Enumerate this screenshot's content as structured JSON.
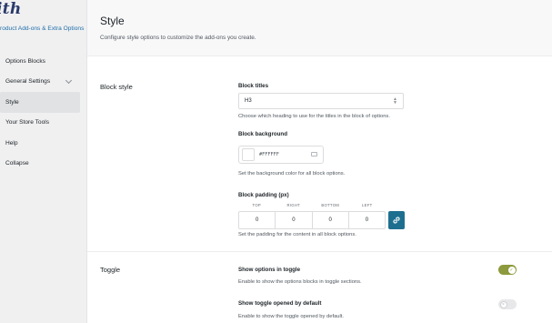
{
  "sidebar": {
    "logo": "ith",
    "plugin_name": "roduct Add-ons & Extra Options",
    "items": [
      {
        "label": "Options Blocks"
      },
      {
        "label": "General Settings"
      },
      {
        "label": "Style"
      },
      {
        "label": "Your Store Tools"
      },
      {
        "label": "Help"
      },
      {
        "label": "Collapse"
      }
    ]
  },
  "header": {
    "title": "Style",
    "description": "Configure style options to customize the add-ons you create."
  },
  "block_style": {
    "section_title": "Block style",
    "titles": {
      "label": "Block titles",
      "value": "H3",
      "help": "Choose which heading to use for the titles in the block of options."
    },
    "background": {
      "label": "Block background",
      "color_value": "#FFFFFF",
      "swatch_color": "#ffffff",
      "help": "Set the background color for all block options."
    },
    "padding": {
      "label": "Block padding (px)",
      "columns": [
        {
          "label": "TOP",
          "value": "0"
        },
        {
          "label": "RIGHT",
          "value": "0"
        },
        {
          "label": "BOTTOM",
          "value": "0"
        },
        {
          "label": "LEFT",
          "value": "0"
        }
      ],
      "help": "Set the padding for the content in all block options."
    }
  },
  "toggle_section": {
    "section_title": "Toggle",
    "show_in_toggle": {
      "label": "Show options in toggle",
      "help": "Enable to show the options blocks in toggle sections.",
      "enabled": true
    },
    "opened_by_default": {
      "label": "Show toggle opened by default",
      "help": "Enable to show the toggle opened by default.",
      "enabled": false
    }
  },
  "colors": {
    "accent": "#1e6f8f",
    "toggle_on": "#8d9a3d",
    "link": "#1e6ea7"
  }
}
